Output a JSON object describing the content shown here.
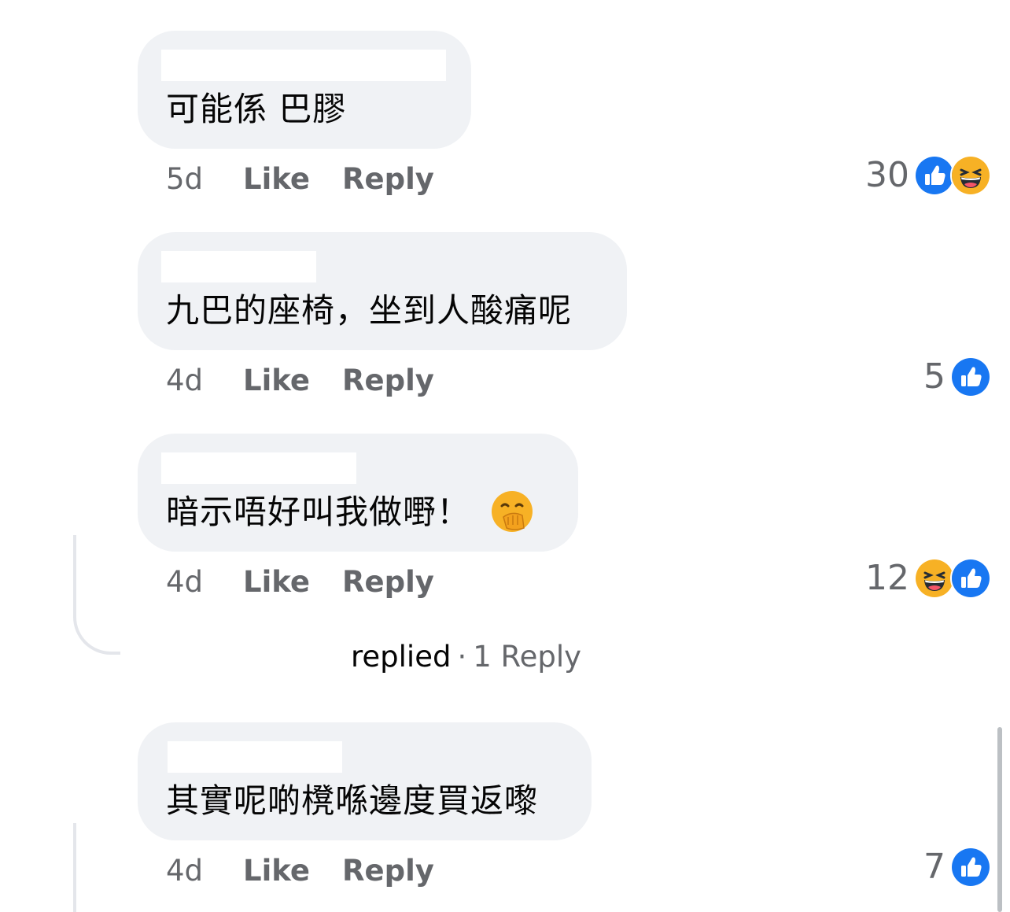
{
  "comments": [
    {
      "text": "可能係 巴膠",
      "time": "5d",
      "like_label": "Like",
      "reply_label": "Reply",
      "reaction_count": "30",
      "reactions": [
        "like-icon",
        "haha-icon"
      ]
    },
    {
      "text": "九巴的座椅，坐到人酸痛呢",
      "time": "4d",
      "like_label": "Like",
      "reply_label": "Reply",
      "reaction_count": "5",
      "reactions": [
        "like-icon"
      ]
    },
    {
      "text": "暗示唔好叫我做嘢！",
      "inline_emoji": "hand-over-mouth-emoji",
      "time": "4d",
      "like_label": "Like",
      "reply_label": "Reply",
      "reaction_count": "12",
      "reactions": [
        "haha-icon",
        "like-icon"
      ],
      "replies": {
        "replied_label": "replied",
        "separator": "·",
        "count_label": "1 Reply"
      }
    },
    {
      "text": "其實呢啲櫈喺邊度買返嚟",
      "time": "4d",
      "like_label": "Like",
      "reply_label": "Reply",
      "reaction_count": "7",
      "reactions": [
        "like-icon"
      ]
    }
  ],
  "colors": {
    "bubble": "#f0f2f5",
    "like_blue": "#1877f2",
    "haha_yellow": "#f7b125",
    "meta_gray": "#65676b",
    "text": "#050505"
  }
}
